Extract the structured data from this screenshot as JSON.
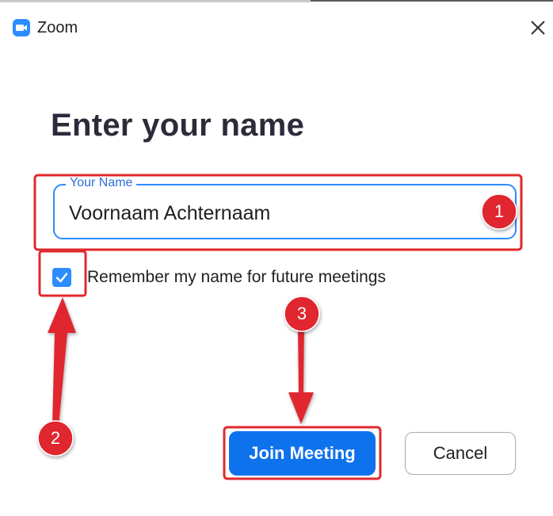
{
  "window": {
    "app_title": "Zoom"
  },
  "dialog": {
    "heading": "Enter your name",
    "name_field": {
      "label": "Your Name",
      "value": "Voornaam Achternaam"
    },
    "remember_checkbox": {
      "label": "Remember my name for future meetings",
      "checked": true
    },
    "join_button_label": "Join Meeting",
    "cancel_button_label": "Cancel"
  },
  "annotations": {
    "markers": [
      "1",
      "2",
      "3"
    ],
    "color": "#e0282e"
  },
  "colors": {
    "accent": "#2d8cff",
    "primary_button": "#0e72ed"
  }
}
